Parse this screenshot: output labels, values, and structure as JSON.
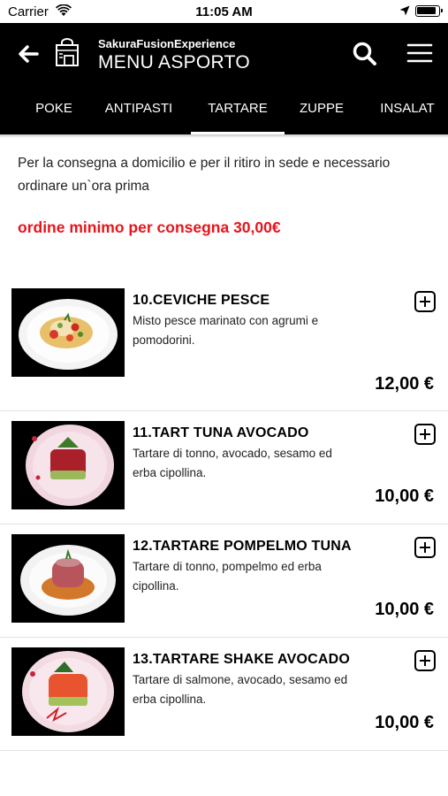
{
  "status_bar": {
    "carrier": "Carrier",
    "time": "11:05 AM"
  },
  "header": {
    "subtitle": "SakuraFusionExperience",
    "title": "MENU ASPORTO"
  },
  "tabs": [
    {
      "label": "POKE"
    },
    {
      "label": "ANTIPASTI"
    },
    {
      "label": "TARTARE",
      "active": true
    },
    {
      "label": "ZUPPE"
    },
    {
      "label": "INSALAT"
    }
  ],
  "info": {
    "text": "Per la consegna a domicilio e per il ritiro in sede e necessario ordinare un`ora prima",
    "min_order": "ordine minimo per consegna 30,00€"
  },
  "products": [
    {
      "name": "10.CEVICHE PESCE",
      "description": "Misto pesce marinato con agrumi e pomodorini.",
      "price": "12,00 €",
      "image": "ceviche-dish"
    },
    {
      "name": "11.TART TUNA AVOCADO",
      "description": "Tartare di tonno, avocado, sesamo ed erba cipollina.",
      "price": "10,00 €",
      "image": "tuna-avocado-tartare-dish"
    },
    {
      "name": "12.TARTARE POMPELMO TUNA",
      "description": "Tartare di tonno, pompelmo ed erba cipollina.",
      "price": "10,00 €",
      "image": "tuna-grapefruit-tartare-dish"
    },
    {
      "name": "13.TARTARE SHAKE AVOCADO",
      "description": "Tartare di salmone, avocado, sesamo ed erba cipollina.",
      "price": "10,00 €",
      "image": "salmon-avocado-tartare-dish"
    }
  ],
  "colors": {
    "header_bg": "#000000",
    "accent_red": "#e8141c",
    "text": "#222222"
  },
  "icons": [
    "back-arrow-icon",
    "shopping-bag-icon",
    "search-icon",
    "hamburger-menu-icon",
    "add-square-icon",
    "wifi-icon",
    "location-arrow-icon",
    "battery-icon"
  ]
}
